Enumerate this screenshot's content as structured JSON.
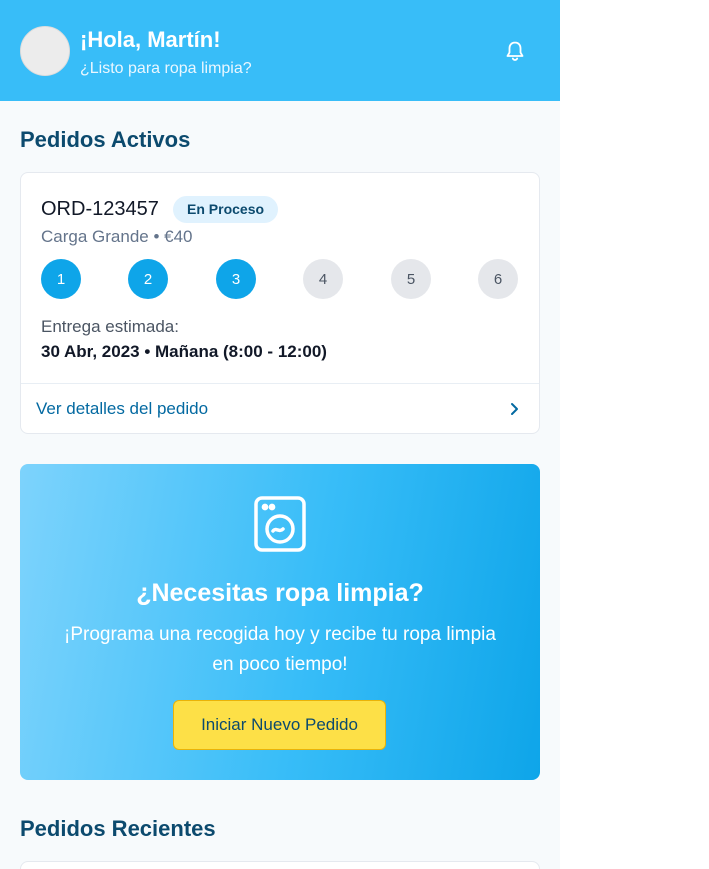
{
  "header": {
    "greeting": "¡Hola, Martín!",
    "subtitle": "¿Listo para ropa limpia?",
    "avatar_icon": "user-avatar",
    "notification_icon": "bell-icon"
  },
  "active_orders": {
    "title": "Pedidos Activos",
    "order": {
      "id": "ORD-123457",
      "status": "En Proceso",
      "meta": "Carga Grande • €40",
      "steps": [
        {
          "label": "1",
          "done": true
        },
        {
          "label": "2",
          "done": true
        },
        {
          "label": "3",
          "done": true
        },
        {
          "label": "4",
          "done": false
        },
        {
          "label": "5",
          "done": false
        },
        {
          "label": "6",
          "done": false
        }
      ],
      "eta_label": "Entrega estimada:",
      "eta_value": "30 Abr, 2023 • Mañana (8:00 - 12:00)",
      "details_link": "Ver detalles del pedido"
    }
  },
  "promo": {
    "icon": "washing-machine-icon",
    "title": "¿Necesitas ropa limpia?",
    "text": "¡Programa una recogida hoy y recibe tu ropa limpia en poco tiempo!",
    "button": "Iniciar Nuevo Pedido"
  },
  "recent_orders": {
    "title": "Pedidos Recientes"
  },
  "colors": {
    "header_bg": "#38bdf8",
    "accent": "#0ea5e9",
    "heading": "#0c4a6e",
    "button_bg": "#fde047"
  }
}
